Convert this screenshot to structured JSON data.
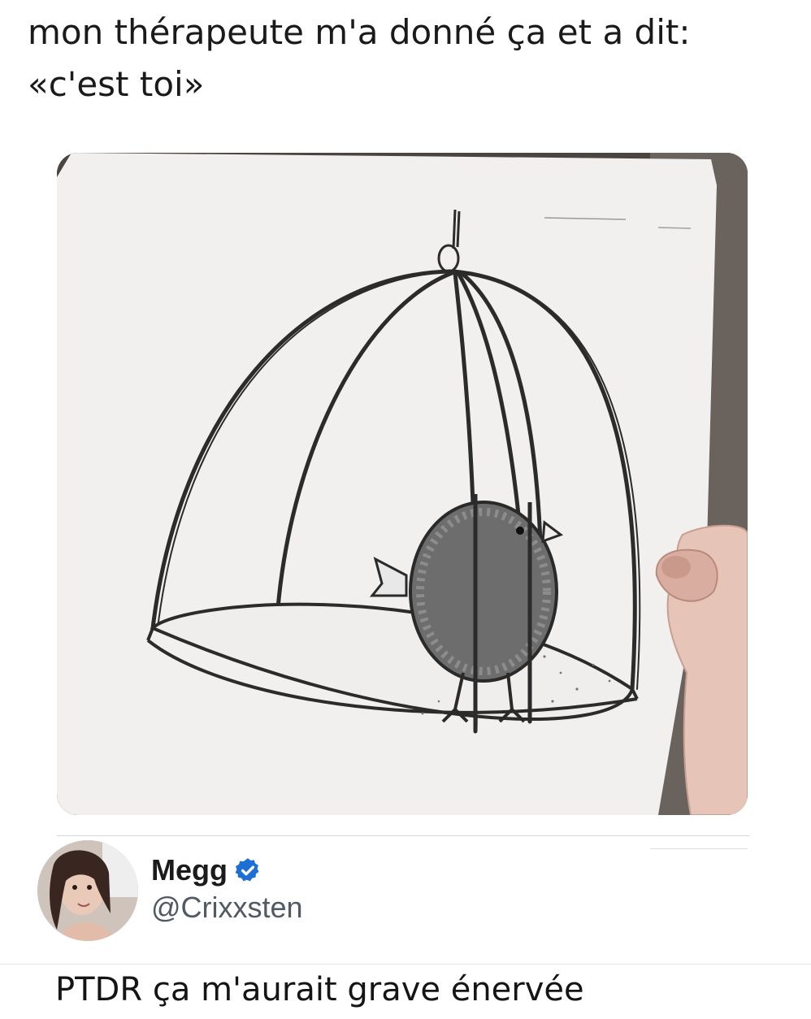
{
  "post": {
    "caption_line1": "mon thérapeute m'a donné ça et a dit:",
    "caption_line2": "«c'est toi»"
  },
  "photo": {
    "subject": "hand holding a printed drawing of a bird in a cage"
  },
  "reply": {
    "author": {
      "display_name": "Megg",
      "handle": "@Crixxsten",
      "verified": true,
      "verified_icon": "verified-badge-icon",
      "verified_color": "#1d6fd6"
    },
    "text": "PTDR ça m'aurait grave énervée"
  }
}
